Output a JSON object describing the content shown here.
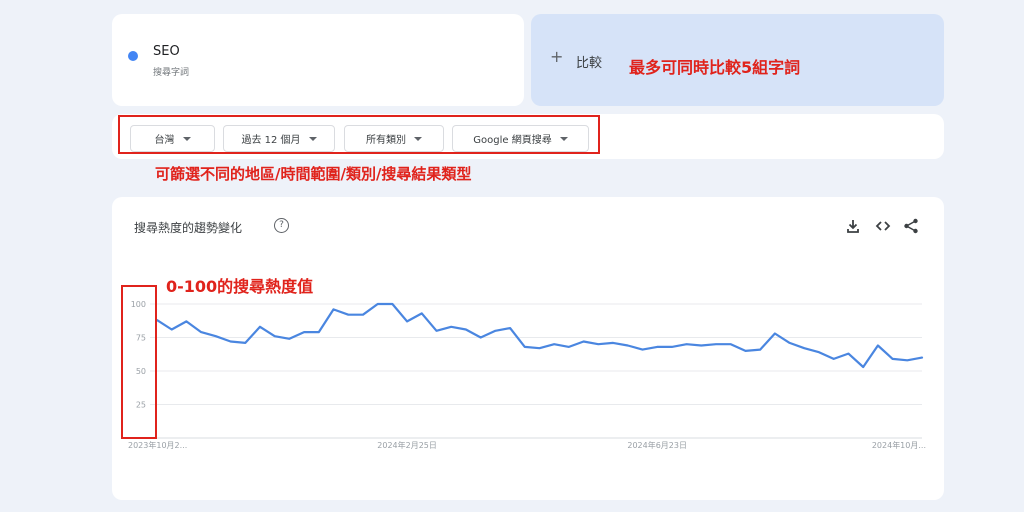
{
  "term": {
    "name": "SEO",
    "subtitle": "搜尋字詞",
    "color": "#4285f4"
  },
  "compare": {
    "plus": "+",
    "label": "比較"
  },
  "filters": [
    {
      "label": "台灣"
    },
    {
      "label": "過去 12 個月"
    },
    {
      "label": "所有類別"
    },
    {
      "label": "Google 網頁搜尋"
    }
  ],
  "annotations": {
    "compare_note": "最多可同時比較5組字詞",
    "filters_note": "可篩選不同的地區/時間範圍/類別/搜尋結果類型",
    "range_note": "0-100的搜尋熱度值",
    "color": "#e0231c"
  },
  "chart_header": {
    "title": "搜尋熱度的趨勢變化",
    "help_icon": "help-circle-icon",
    "tools": [
      "download-icon",
      "embed-code-icon",
      "share-icon"
    ]
  },
  "chart_data": {
    "type": "line",
    "yticks": [
      100,
      75,
      50,
      25
    ],
    "ylim": [
      0,
      100
    ],
    "xtick_labels": [
      "2023年10月2...",
      "2024年2月25日",
      "2024年6月23日",
      "2024年10月..."
    ],
    "xtick_index": [
      0,
      17,
      34,
      51
    ],
    "series": [
      {
        "color": "#4a86e0",
        "values": [
          88,
          81,
          87,
          79,
          76,
          72,
          71,
          83,
          76,
          74,
          79,
          79,
          96,
          92,
          92,
          100,
          100,
          87,
          93,
          80,
          83,
          81,
          75,
          80,
          82,
          68,
          67,
          70,
          68,
          72,
          70,
          71,
          69,
          66,
          68,
          68,
          70,
          69,
          70,
          70,
          65,
          66,
          78,
          71,
          67,
          64,
          59,
          63,
          53,
          69,
          59,
          58,
          60
        ]
      }
    ]
  }
}
